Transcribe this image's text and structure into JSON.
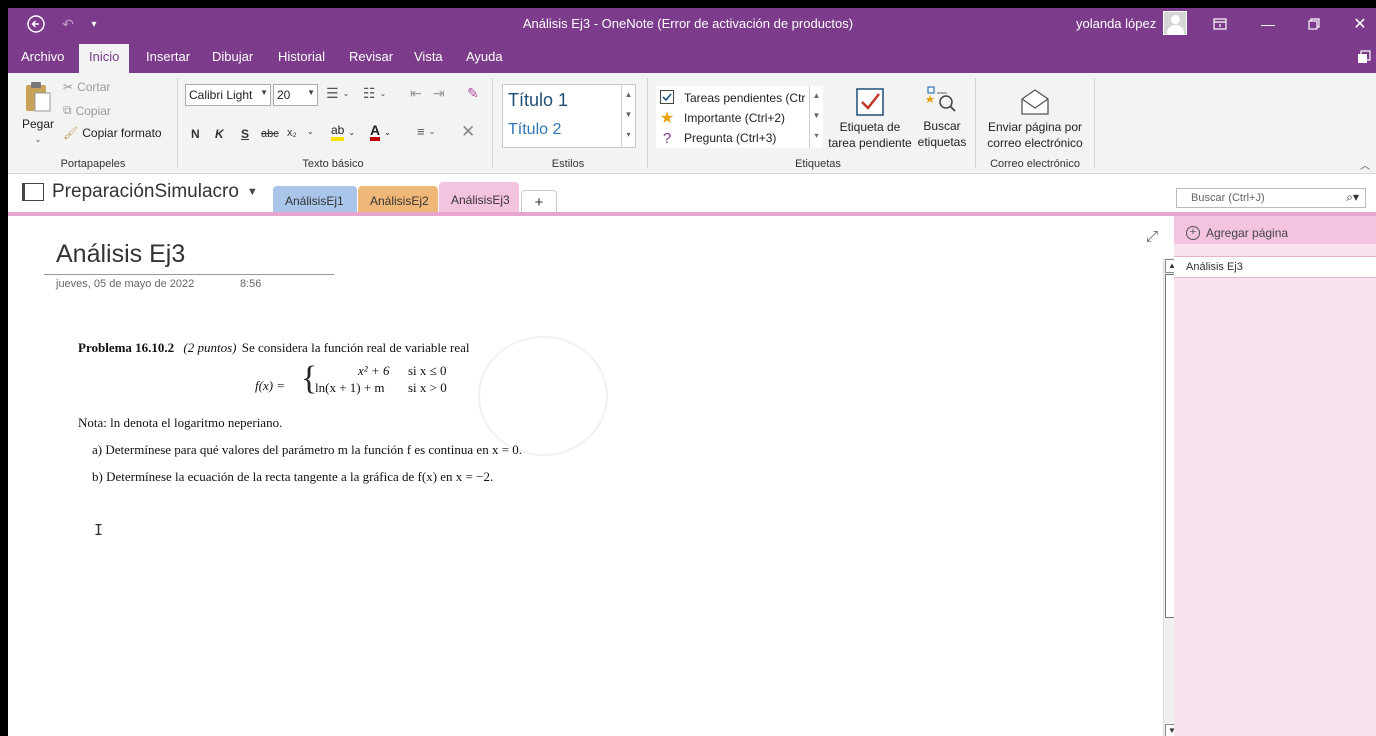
{
  "window": {
    "title": "Análisis Ej3  -  OneNote (Error de activación de productos)",
    "user": "yolanda lópez"
  },
  "menu": [
    "Archivo",
    "Inicio",
    "Insertar",
    "Dibujar",
    "Historial",
    "Revisar",
    "Vista",
    "Ayuda"
  ],
  "ribbon": {
    "clipboard": {
      "paste": "Pegar",
      "cut": "Cortar",
      "copy": "Copiar",
      "format_painter": "Copiar formato",
      "label": "Portapapeles"
    },
    "basic_text": {
      "font": "Calibri Light",
      "size": "20",
      "bold": "N",
      "italic": "K",
      "underline": "S",
      "strike": "abc",
      "subscript": "x₂",
      "label": "Texto básico"
    },
    "styles": {
      "title1": "Título 1",
      "title2": "Título 2",
      "label": "Estilos"
    },
    "tags": {
      "items": [
        "Tareas pendientes (Ctr",
        "Importante (Ctrl+2)",
        "Pregunta (Ctrl+3)"
      ],
      "todo_tag": [
        "Etiqueta de",
        "tarea pendiente"
      ],
      "find_tags": [
        "Buscar",
        "etiquetas"
      ],
      "label": "Etiquetas"
    },
    "email": {
      "send": [
        "Enviar página por",
        "correo electrónico"
      ],
      "label": "Correo electrónico"
    }
  },
  "notebook": {
    "name": "PreparaciónSimulacro",
    "sections": [
      {
        "label": "AnálisisEj1",
        "color": "#a9c5ea"
      },
      {
        "label": "AnálisisEj2",
        "color": "#f0b878"
      },
      {
        "label": "AnálisisEj3",
        "color": "#f3c3e0"
      }
    ],
    "add_section": "+",
    "search_placeholder": "Buscar (Ctrl+J)"
  },
  "page": {
    "title": "Análisis Ej3",
    "date": "jueves, 05 de mayo de 2022",
    "time": "8:56",
    "problem": {
      "heading": "Problema 16.10.2",
      "points": "(2 puntos)",
      "intro": "Se considera la función real de variable real",
      "fx": "f(x) =",
      "case1_expr": "x² + 6",
      "case1_cond": "si   x ≤ 0",
      "case2_expr": "ln(x + 1) + m",
      "case2_cond": "si   x > 0",
      "note": "Nota: ln denota el logaritmo neperiano.",
      "a": "a)  Determínese para qué valores del parámetro m la función f es continua en x = 0.",
      "b": "b)  Determínese la ecuación de la recta tangente a la gráfica de f(x) en x = −2."
    }
  },
  "pages_panel": {
    "add_page": "Agregar página",
    "pages": [
      "Análisis Ej3"
    ]
  },
  "colors": {
    "brand": "#7d3b8c",
    "section_pink": "#e8a6cf"
  }
}
